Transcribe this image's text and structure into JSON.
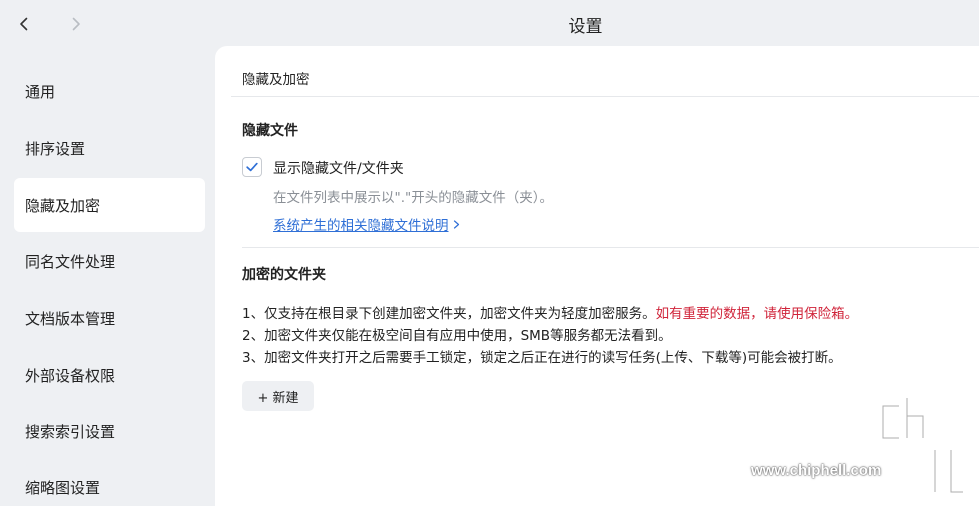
{
  "window": {
    "title": "设置"
  },
  "sidebar": {
    "items": [
      {
        "label": "通用"
      },
      {
        "label": "排序设置"
      },
      {
        "label": "隐藏及加密"
      },
      {
        "label": "同名文件处理"
      },
      {
        "label": "文档版本管理"
      },
      {
        "label": "外部设备权限"
      },
      {
        "label": "搜索索引设置"
      },
      {
        "label": "缩略图设置"
      }
    ],
    "active_index": 2
  },
  "main": {
    "header": "隐藏及加密",
    "hidden_files": {
      "title": "隐藏文件",
      "checkbox_label": "显示隐藏文件/文件夹",
      "checked": true,
      "description": "在文件列表中展示以\".\"开头的隐藏文件（夹）。",
      "link_text": "系统产生的相关隐藏文件说明"
    },
    "encrypted_folders": {
      "title": "加密的文件夹",
      "rules": [
        {
          "text": "1、仅支持在根目录下创建加密文件夹，加密文件夹为轻度加密服务。",
          "warning": "如有重要的数据，请使用保险箱。"
        },
        {
          "text": "2、加密文件夹仅能在极空间自有应用中使用，SMB等服务都无法看到。",
          "warning": ""
        },
        {
          "text": "3、加密文件夹打开之后需要手工锁定，锁定之后正在进行的读写任务(上传、下载等)可能会被打断。",
          "warning": ""
        }
      ],
      "new_button": "+ 新建"
    }
  },
  "watermark": {
    "text": "www.chiphell.com"
  },
  "colors": {
    "accent": "#2f6fd6",
    "warning": "#d0243a",
    "sidebar_bg": "#eef0f3",
    "panel_bg": "#ffffff"
  }
}
